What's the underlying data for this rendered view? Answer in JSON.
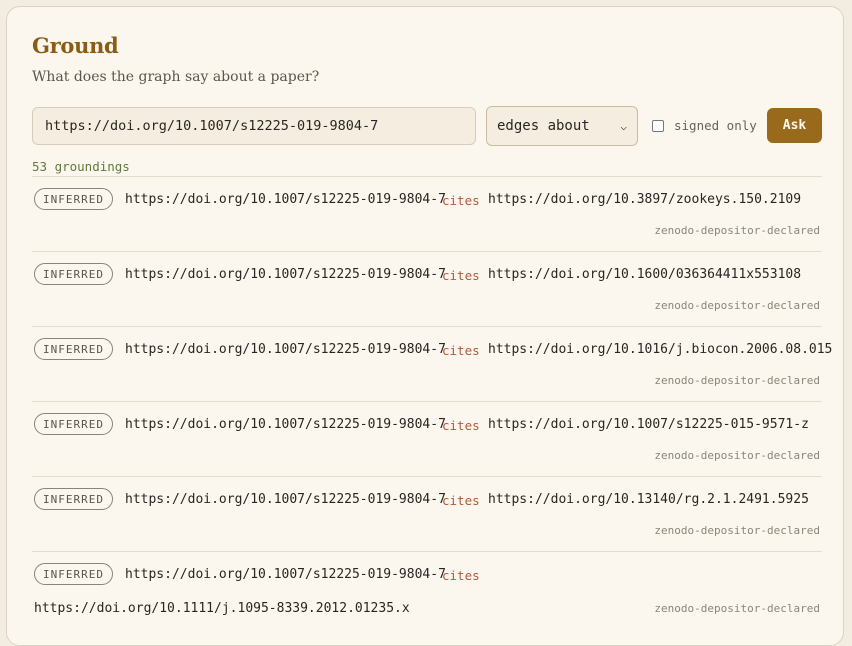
{
  "app": {
    "title": "Ground",
    "subtitle": "What does the graph say about a paper?"
  },
  "search": {
    "query_value": "https://doi.org/10.1007/s12225-019-9804-7",
    "mode_selected": "edges about",
    "signed_only_label": "signed only",
    "signed_only_checked": false,
    "ask_label": "Ask"
  },
  "results": {
    "count_label": "53 groundings",
    "rows": [
      {
        "badge": "INFERRED",
        "subject": "https://doi.org/10.1007/s12225-019-9804-7",
        "predicate": "cites",
        "object": "https://doi.org/10.3897/zookeys.150.2109",
        "source": "zenodo-depositor-declared"
      },
      {
        "badge": "INFERRED",
        "subject": "https://doi.org/10.1007/s12225-019-9804-7",
        "predicate": "cites",
        "object": "https://doi.org/10.1600/036364411x553108",
        "source": "zenodo-depositor-declared"
      },
      {
        "badge": "INFERRED",
        "subject": "https://doi.org/10.1007/s12225-019-9804-7",
        "predicate": "cites",
        "object": "https://doi.org/10.1016/j.biocon.2006.08.015",
        "source": "zenodo-depositor-declared"
      },
      {
        "badge": "INFERRED",
        "subject": "https://doi.org/10.1007/s12225-019-9804-7",
        "predicate": "cites",
        "object": "https://doi.org/10.1007/s12225-015-9571-z",
        "source": "zenodo-depositor-declared"
      },
      {
        "badge": "INFERRED",
        "subject": "https://doi.org/10.1007/s12225-019-9804-7",
        "predicate": "cites",
        "object": "https://doi.org/10.13140/rg.2.1.2491.5925",
        "source": "zenodo-depositor-declared"
      },
      {
        "badge": "INFERRED",
        "subject": "https://doi.org/10.1007/s12225-019-9804-7",
        "predicate": "cites",
        "object": "https://doi.org/10.1111/j.1095-8339.2012.01235.x",
        "source": "zenodo-depositor-declared"
      }
    ]
  },
  "colors": {
    "brand": "#8a5c14",
    "button": "#9a6a1c",
    "predicate": "#b05a3c",
    "count": "#5f7a3a"
  }
}
